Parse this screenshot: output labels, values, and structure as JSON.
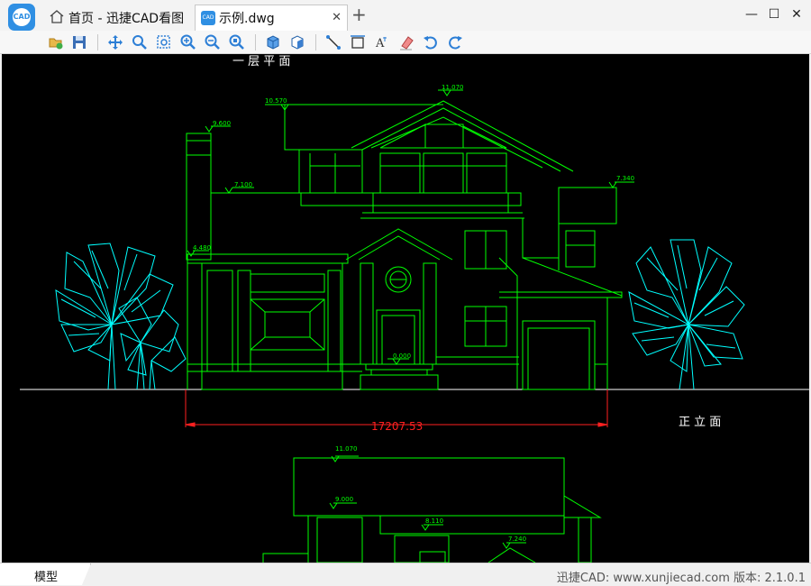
{
  "window": {
    "home_tab_label": "首页 - 迅捷CAD看图",
    "file_tab_label": "示例.dwg",
    "app_logo_text": "CAD"
  },
  "toolbar": {
    "tools": [
      "open-file-icon",
      "save-icon",
      "pan-icon",
      "zoom-realtime-icon",
      "zoom-window-icon",
      "zoom-in-icon",
      "zoom-out-icon",
      "zoom-extents-icon",
      "3d-view-icon",
      "layer-icon",
      "measure-line-icon",
      "measure-area-icon",
      "text-icon",
      "erase-icon",
      "undo-icon",
      "redo-icon"
    ]
  },
  "drawing": {
    "top_title": "一 层 平 面",
    "elevation_label": "正 立 面",
    "dimension_value": "17207.53",
    "level_marks": {
      "ridge": "11.070",
      "left_top": "10.570",
      "chimney": "9.600",
      "mid": "7.100",
      "right": "7.340",
      "eave": "4.480",
      "ground": "0.000",
      "lower_ridge": "11.070",
      "lower_mid": "9.000",
      "lower_right": "8.110",
      "lower_small": "7.240"
    },
    "colors": {
      "line": "#00ff00",
      "tree": "#00ffff",
      "dim": "#ff2020",
      "text": "#ffffff"
    }
  },
  "statusbar": {
    "model_tab_label": "模型",
    "info_text": "迅捷CAD: www.xunjiecad.com 版本: 2.1.0.1"
  }
}
